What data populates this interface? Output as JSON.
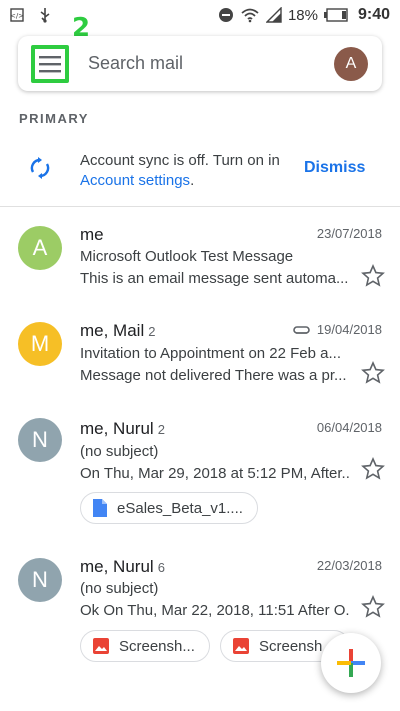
{
  "status_bar": {
    "battery_percent": "18%",
    "time": "9:40",
    "icons": [
      "code-icon",
      "usb-icon",
      "do-not-disturb-icon",
      "wifi-icon",
      "signal-icon",
      "battery-icon"
    ]
  },
  "search": {
    "placeholder": "Search mail",
    "account_initial": "A",
    "annotation_label": "2"
  },
  "section": {
    "label": "PRIMARY"
  },
  "sync_banner": {
    "text_part1": "Account sync is off. Turn on in ",
    "link_text": "Account settings",
    "text_part2": ".",
    "dismiss_label": "Dismiss"
  },
  "emails": [
    {
      "initial": "A",
      "avatar_color": "#9ccc65",
      "sender": "me",
      "count": "",
      "date": "23/07/2018",
      "subject": "Microsoft Outlook Test Message",
      "snippet": "This is an email message sent automa..."
    },
    {
      "initial": "M",
      "avatar_color": "#f6bf26",
      "sender": "me, Mail",
      "count": "2",
      "date": "19/04/2018",
      "subject": "Invitation to Appointment on 22 Feb a...",
      "snippet": "Message not delivered There was a pr..."
    },
    {
      "initial": "N",
      "avatar_color": "#90a4ae",
      "sender": "me, Nurul",
      "count": "2",
      "date": "06/04/2018",
      "subject": "(no subject)",
      "snippet": "On Thu, Mar 29, 2018 at 5:12 PM, After...",
      "attachment": "eSales_Beta_v1...."
    },
    {
      "initial": "N",
      "avatar_color": "#90a4ae",
      "sender": "me, Nurul",
      "count": "6",
      "date": "22/03/2018",
      "subject": "(no subject)",
      "snippet": "Ok On Thu, Mar 22, 2018, 11:51 After O...",
      "attachments": [
        "Screensh...",
        "Screensh"
      ]
    }
  ],
  "colors": {
    "accent_blue": "#1a73e8",
    "annotation_green": "#2ecc40"
  }
}
